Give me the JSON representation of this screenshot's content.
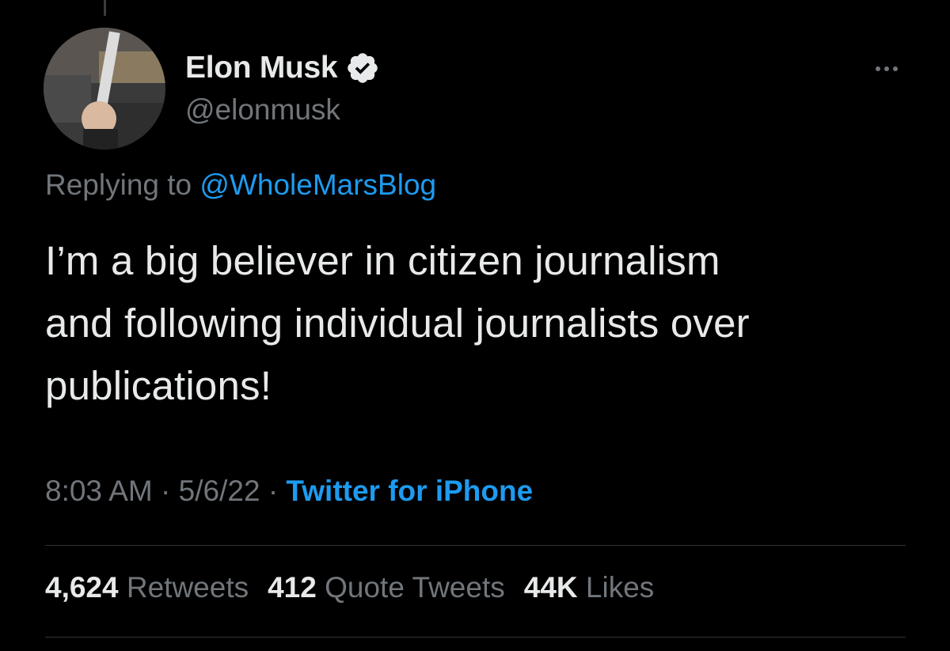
{
  "author": {
    "display_name": "Elon Musk",
    "handle": "@elonmusk",
    "verified": true
  },
  "reply": {
    "prefix": "Replying to",
    "mention": "@WholeMarsBlog"
  },
  "tweet": {
    "line1": "I’m a big believer in citizen journalism",
    "line2": "and following individual journalists over",
    "line3": "publications!"
  },
  "meta": {
    "time": "8:03 AM",
    "sep1": "·",
    "date": "5/6/22",
    "sep2": "·",
    "source": "Twitter for iPhone"
  },
  "stats": {
    "retweets_count": "4,624",
    "retweets_label": "Retweets",
    "quotes_count": "412",
    "quotes_label": "Quote Tweets",
    "likes_count": "44K",
    "likes_label": "Likes"
  },
  "colors": {
    "background": "#000000",
    "primary_text": "#e7e9ea",
    "secondary_text": "#71767b",
    "accent": "#1d9bf0"
  },
  "icons": {
    "verified": "verified-badge-icon",
    "more": "more-horizontal-icon"
  }
}
